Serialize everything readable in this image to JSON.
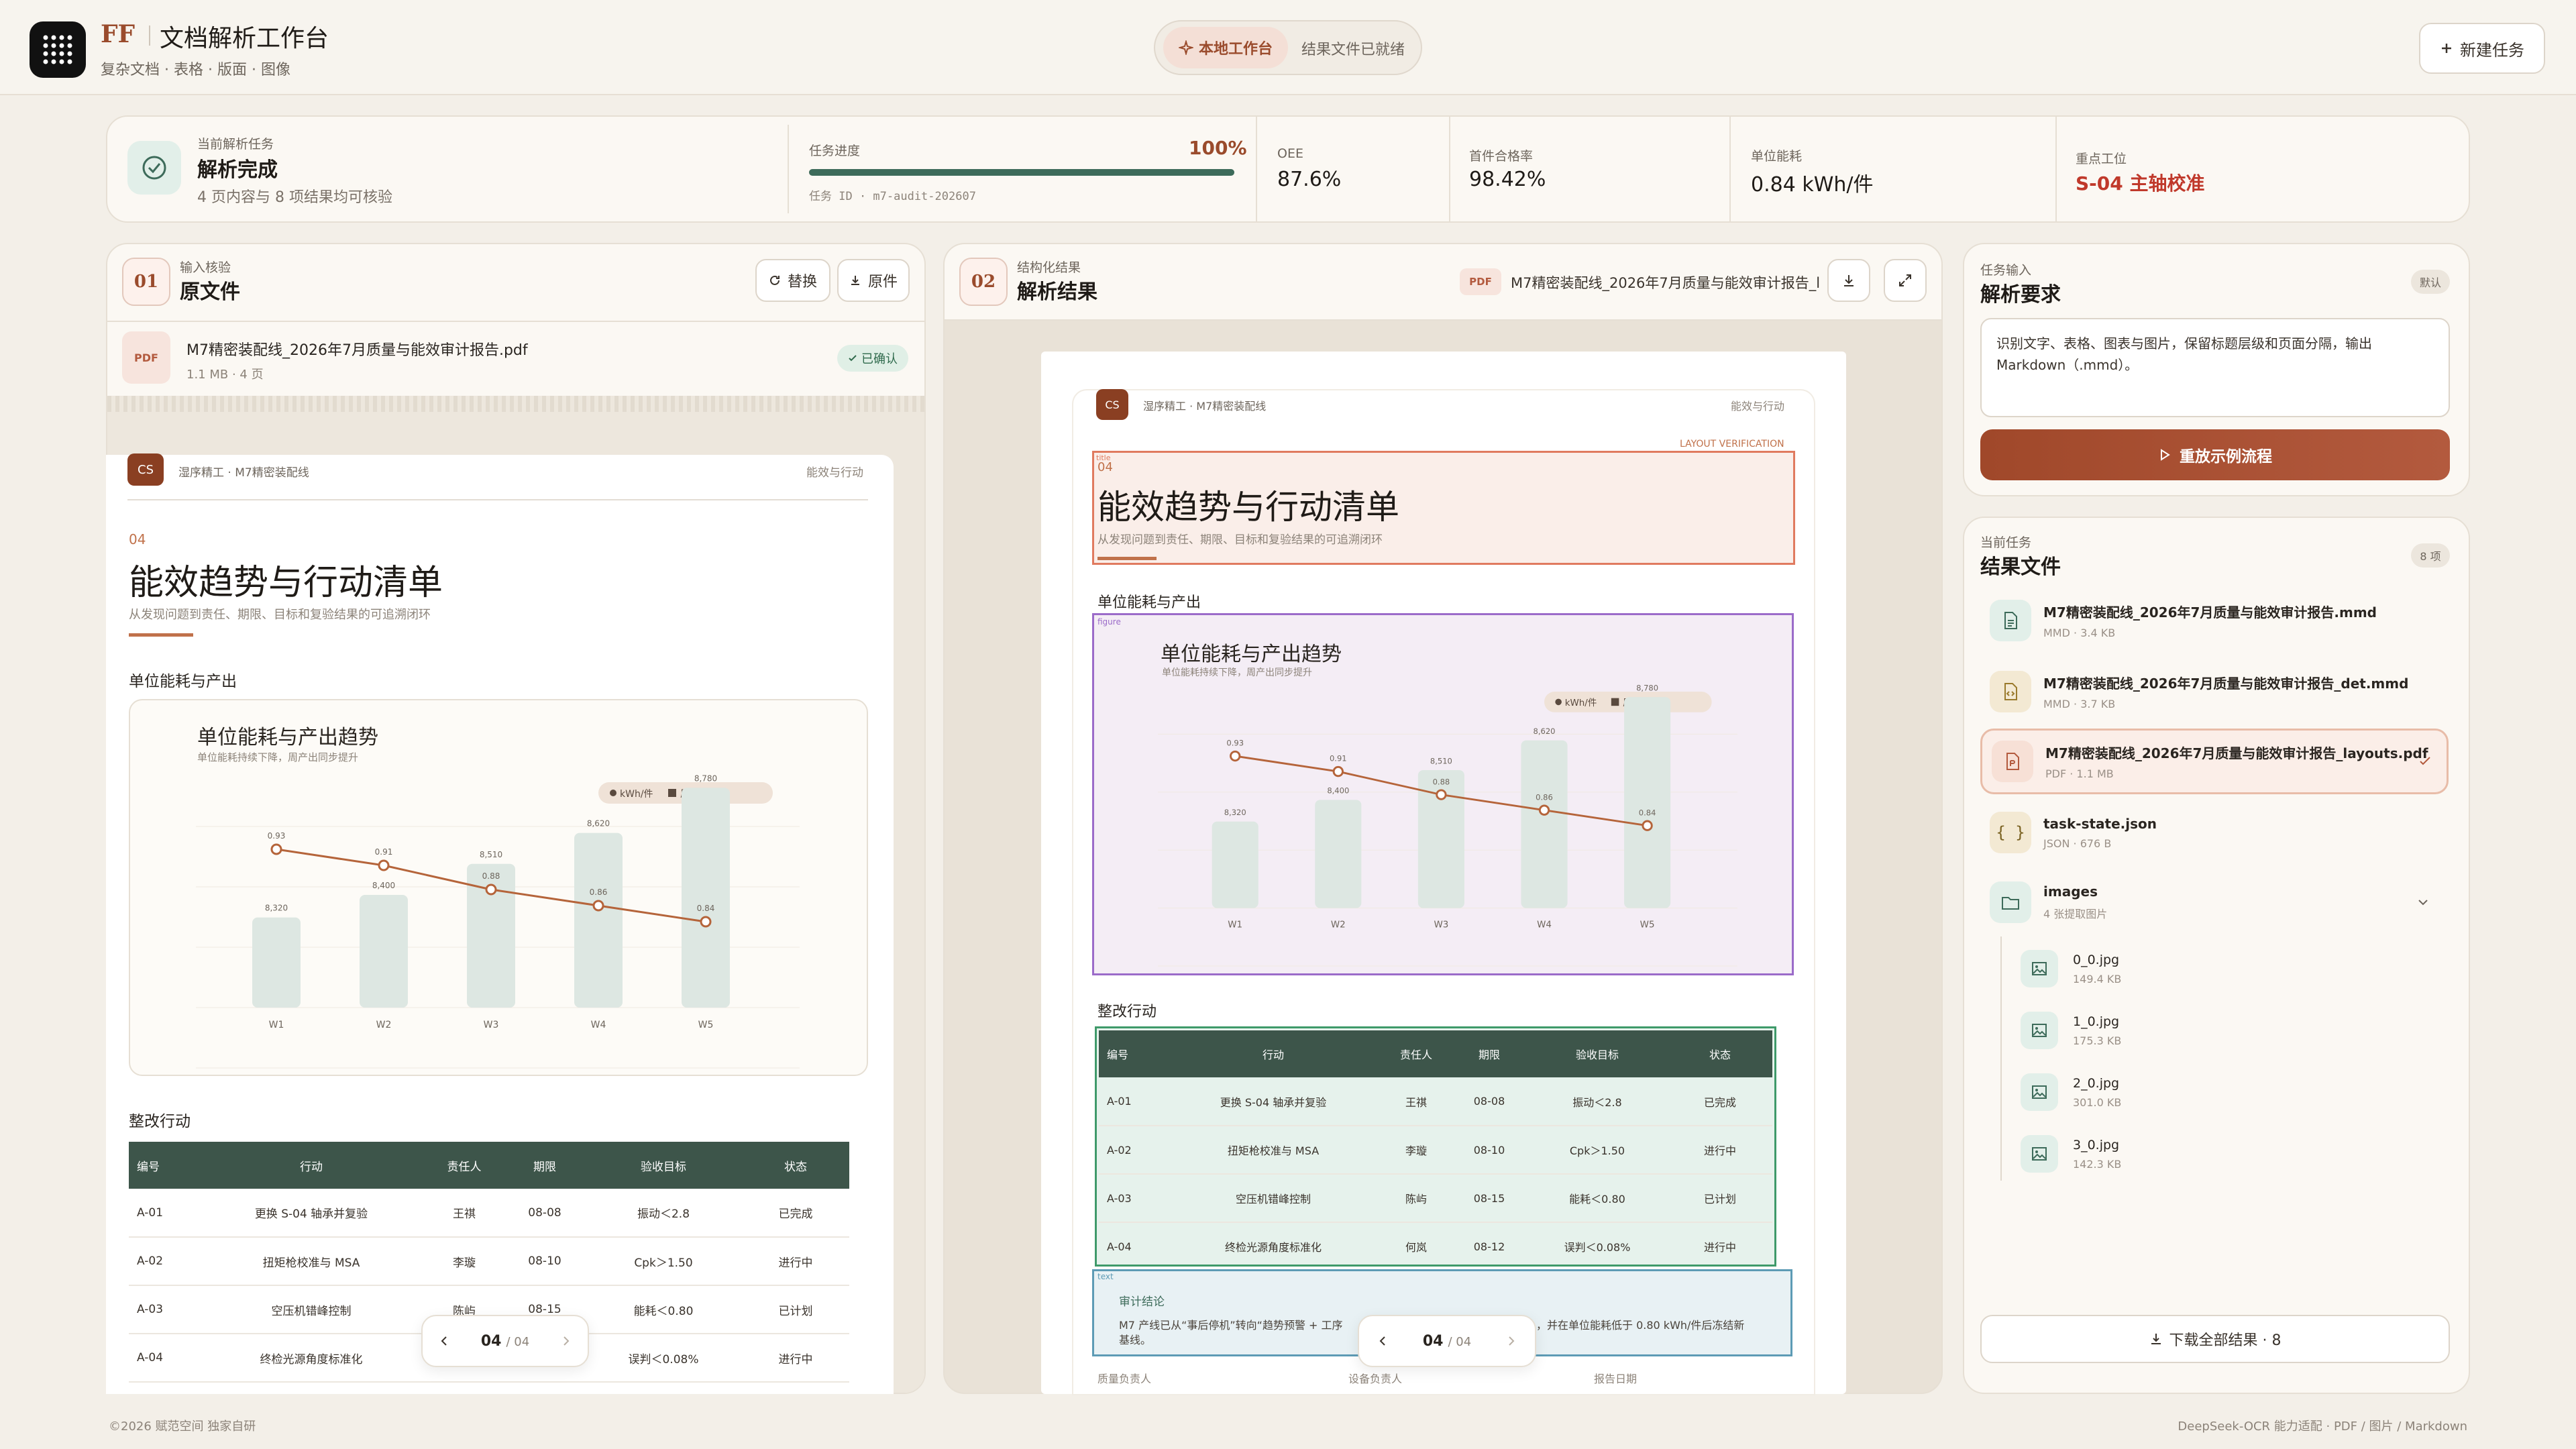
{
  "header": {
    "logo_mark": "FF",
    "app_title": "文档解析工作台",
    "subtitle": "复杂文档 · 表格 · 版面 · 图像",
    "status_chip": "本地工作台",
    "status_text": "结果文件已就绪",
    "new_task_label": "新建任务"
  },
  "summary": {
    "task_label": "当前解析任务",
    "task_status": "解析完成",
    "task_desc": "4 页内容与 8 项结果均可核验",
    "progress_label": "任务进度",
    "progress_value": "100%",
    "progress_fraction": 1.0,
    "task_id": "任务 ID · m7-audit-202607",
    "metrics": [
      {
        "label": "OEE",
        "value": "87.6%"
      },
      {
        "label": "首件合格率",
        "value": "98.42%"
      },
      {
        "label": "单位能耗",
        "value": "0.84 kWh/件"
      },
      {
        "label": "重点工位",
        "value": "S-04 主轴校准"
      }
    ],
    "alert_color": "#c0392b"
  },
  "source_panel": {
    "num": "01",
    "label": "输入核验",
    "title": "原文件",
    "replace_label": "替换",
    "original_label": "原件",
    "file_name": "M7精密装配线_2026年7月质量与能效审计报告.pdf",
    "file_meta": "1.1 MB · 4 页",
    "file_type": "PDF",
    "confirmed_label": "已确认",
    "pager_current": "04",
    "pager_total": "/ 04"
  },
  "result_panel": {
    "num": "02",
    "label": "结构化结果",
    "title": "解析结果",
    "file_type": "PDF",
    "file_name": "M7精密装配线_2026年7月质量与能效审计报告_l...",
    "pager_current": "04",
    "pager_total": "/ 04",
    "layout_tag": "LAYOUT VERIFICATION",
    "title_tag": "title",
    "figure_tag": "figure",
    "text_tag": "text",
    "audit_title": "审计结论",
    "audit_text_1": "M7 产线已从“事后停机”转向“趋势预警 + 工序",
    "audit_text_2": "，并在单位能耗低于 0.80 kWh/件后冻结新",
    "audit_text_3": "基线。",
    "footer_sign": [
      "质量负责人",
      "设备负责人",
      "报告日期"
    ]
  },
  "doc": {
    "logo": "CS",
    "company": "湿序精工 · M7精密装配线",
    "section_tag": "能效与行动",
    "section_num": "04",
    "title": "能效趋势与行动清单",
    "subtitle": "从发现问题到责任、期限、目标和复验结果的可追溯闭环",
    "chart_heading": "单位能耗与产出",
    "table_heading": "整改行动",
    "table_headers": [
      "编号",
      "行动",
      "责任人",
      "期限",
      "验收目标",
      "状态"
    ],
    "table_rows": [
      [
        "A-01",
        "更换 S-04 轴承并复验",
        "王祺",
        "08-08",
        "振动＜2.8",
        "已完成"
      ],
      [
        "A-02",
        "扭矩枪校准与 MSA",
        "李璇",
        "08-10",
        "Cpk＞1.50",
        "进行中"
      ],
      [
        "A-03",
        "空压机错峰控制",
        "陈屿",
        "08-15",
        "能耗＜0.80",
        "已计划"
      ],
      [
        "A-04",
        "终检光源角度标准化",
        "何岚",
        "08-12",
        "误判＜0.08%",
        "进行中"
      ]
    ]
  },
  "chart_data": {
    "type": "bar",
    "title": "单位能耗与产出趋势",
    "subtitle": "单位能耗持续下降，周产出同步提升",
    "categories": [
      "W1",
      "W2",
      "W3",
      "W4",
      "W5"
    ],
    "series": [
      {
        "name": "kWh/件",
        "type": "line",
        "values": [
          0.93,
          0.91,
          0.88,
          0.86,
          0.84
        ],
        "labels": [
          "0.93",
          "0.91",
          "0.88",
          "0.86",
          "0.84"
        ]
      },
      {
        "name": "周产出",
        "type": "bar",
        "values": [
          8320,
          8400,
          8510,
          8620,
          8780
        ],
        "labels": [
          "8,320",
          "8,400",
          "8,510",
          "8,620",
          "8,780"
        ]
      }
    ],
    "legend_position": "top-right",
    "colors": {
      "line": "#b5643a",
      "bar": "#dde7e2"
    }
  },
  "task_input": {
    "label": "任务输入",
    "title": "解析要求",
    "default_label": "默认",
    "prompt_text": "识别文字、表格、图表与图片，保留标题层级和页面分隔，输出 Markdown（.mmd）。",
    "replay_label": "重放示例流程"
  },
  "results": {
    "label": "当前任务",
    "title": "结果文件",
    "count_label": "8 项",
    "files": [
      {
        "name": "M7精密装配线_2026年7月质量与能效审计报告.mmd",
        "meta": "MMD · 3.4 KB",
        "icon": "document-icon"
      },
      {
        "name": "M7精密装配线_2026年7月质量与能效审计报告_det.mmd",
        "meta": "MMD · 3.7 KB",
        "icon": "code-file-icon"
      },
      {
        "name": "M7精密装配线_2026年7月质量与能效审计报告_layouts.pdf",
        "meta": "PDF · 1.1 MB",
        "icon": "pdf-file-icon"
      },
      {
        "name": "task-state.json",
        "meta": "JSON · 676 B",
        "icon": "braces-icon"
      }
    ],
    "folder": {
      "name": "images",
      "meta": "4 张提取图片"
    },
    "images": [
      {
        "name": "0_0.jpg",
        "meta": "149.4 KB"
      },
      {
        "name": "1_0.jpg",
        "meta": "175.3 KB"
      },
      {
        "name": "2_0.jpg",
        "meta": "301.0 KB"
      },
      {
        "name": "3_0.jpg",
        "meta": "142.3 KB"
      }
    ],
    "download_label": "下载全部结果 · 8"
  },
  "footer": {
    "left": "©2026 赋范空间 独家自研",
    "right": "DeepSeek-OCR 能力适配 · PDF / 图片 / Markdown"
  }
}
